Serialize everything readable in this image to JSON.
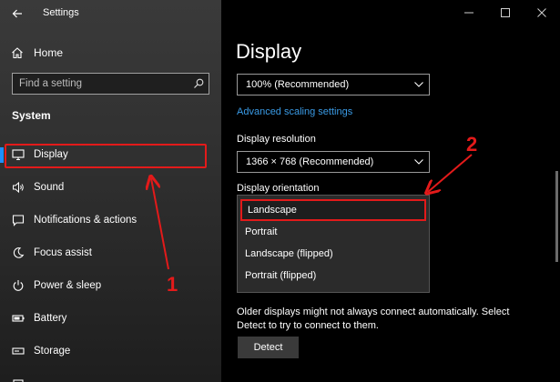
{
  "window": {
    "app_title": "Settings",
    "controls": {
      "minimize": "—",
      "maximize": "☐",
      "close": "✕"
    }
  },
  "sidebar": {
    "home_label": "Home",
    "search_placeholder": "Find a setting",
    "section_title": "System",
    "items": [
      {
        "label": "Display",
        "icon": "monitor-icon",
        "selected": true
      },
      {
        "label": "Sound",
        "icon": "speaker-icon"
      },
      {
        "label": "Notifications & actions",
        "icon": "notification-icon"
      },
      {
        "label": "Focus assist",
        "icon": "moon-icon"
      },
      {
        "label": "Power & sleep",
        "icon": "power-icon"
      },
      {
        "label": "Battery",
        "icon": "battery-icon"
      },
      {
        "label": "Storage",
        "icon": "storage-icon"
      }
    ]
  },
  "main": {
    "title": "Display",
    "scale_value": "100% (Recommended)",
    "advanced_scaling_link": "Advanced scaling settings",
    "resolution_label": "Display resolution",
    "resolution_value": "1366 × 768 (Recommended)",
    "orientation_label": "Display orientation",
    "orientation_options": [
      "Landscape",
      "Portrait",
      "Landscape (flipped)",
      "Portrait (flipped)"
    ],
    "orientation_selected": "Landscape",
    "helper_text": "Older displays might not always connect automatically. Select Detect to try to connect to them.",
    "detect_button": "Detect"
  },
  "annotations": {
    "label_1": "1",
    "label_2": "2",
    "color": "#e31a1a"
  },
  "colors": {
    "accent": "#1e90ff",
    "link": "#3a9be6",
    "highlight": "#e31a1a"
  }
}
